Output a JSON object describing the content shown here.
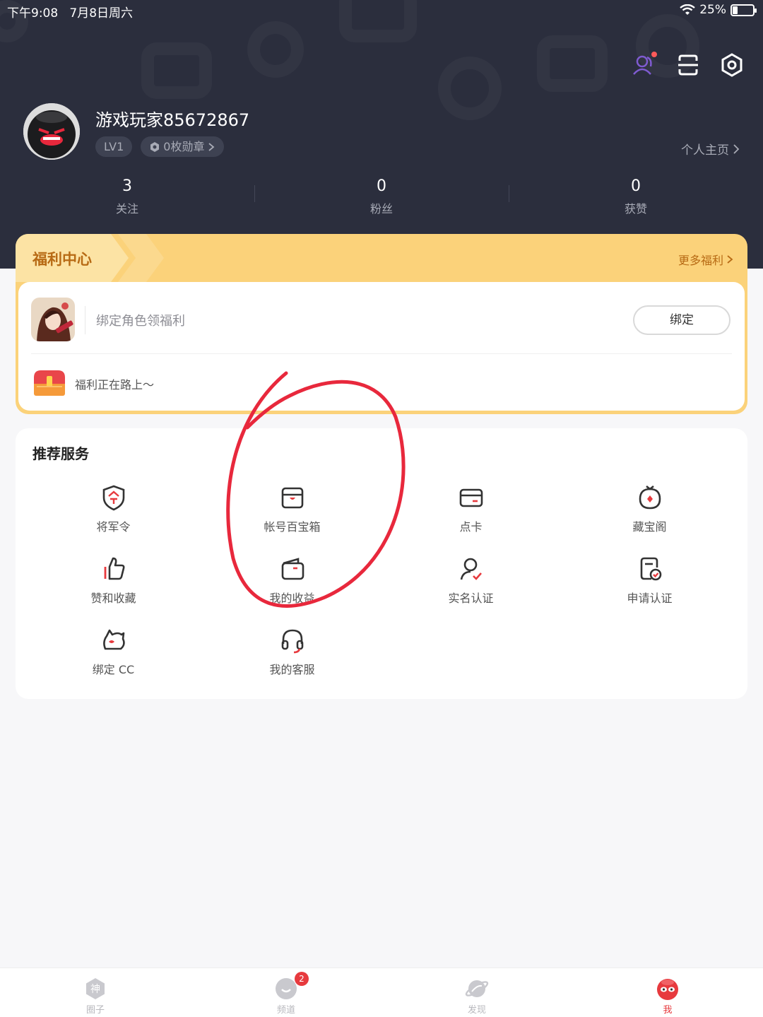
{
  "status_bar": {
    "time": "下午9:08",
    "date": "7月8日周六",
    "battery": "25%"
  },
  "profile": {
    "username": "游戏玩家85672867",
    "level": "LV1",
    "badges": "0枚勋章",
    "homepage_link": "个人主页"
  },
  "stats": [
    {
      "value": "3",
      "label": "关注"
    },
    {
      "value": "0",
      "label": "粉丝"
    },
    {
      "value": "0",
      "label": "获赞"
    }
  ],
  "welfare": {
    "title": "福利中心",
    "more": "更多福利",
    "bind_text": "绑定角色领福利",
    "bind_button": "绑定",
    "on_the_way": "福利正在路上～"
  },
  "services": {
    "title": "推荐服务",
    "items": [
      {
        "label": "将军令",
        "icon": "shield-order-icon"
      },
      {
        "label": "帐号百宝箱",
        "icon": "treasure-box-icon"
      },
      {
        "label": "点卡",
        "icon": "card-icon"
      },
      {
        "label": "藏宝阁",
        "icon": "treasure-pavilion-icon"
      },
      {
        "label": "赞和收藏",
        "icon": "thumbs-up-icon"
      },
      {
        "label": "我的收益",
        "icon": "wallet-icon"
      },
      {
        "label": "实名认证",
        "icon": "user-verify-icon"
      },
      {
        "label": "申请认证",
        "icon": "certificate-icon"
      },
      {
        "label": "绑定 CC",
        "icon": "cc-bind-icon"
      },
      {
        "label": "我的客服",
        "icon": "headset-icon"
      }
    ]
  },
  "tabbar": [
    {
      "label": "圈子",
      "icon": "circle-icon",
      "active": false
    },
    {
      "label": "频道",
      "icon": "channel-icon",
      "active": false,
      "badge": "2"
    },
    {
      "label": "发现",
      "icon": "planet-icon",
      "active": false
    },
    {
      "label": "我",
      "icon": "me-icon",
      "active": true
    }
  ],
  "colors": {
    "header_bg": "#2b2e3d",
    "welfare_bg": "#fbd27a",
    "accent_red": "#e73a3e",
    "annotation_red": "#e8283c"
  }
}
